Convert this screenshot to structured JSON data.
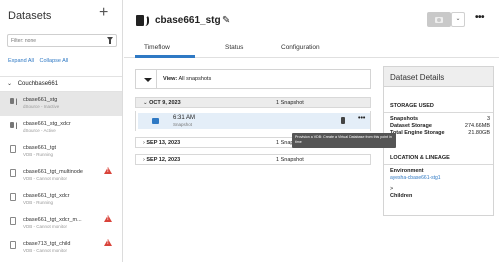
{
  "sidebar": {
    "title": "Datasets",
    "add_glyph": "+",
    "filter_placeholder": "Filter: none",
    "expand_all": "Expand All",
    "collapse_all": "Collapse All",
    "group": "Couchbase661",
    "items": [
      {
        "name": "cbase661_stg",
        "status": "dSource - Inactive",
        "type": "source",
        "selected": true,
        "warning": false
      },
      {
        "name": "cbase661_stg_xdcr",
        "status": "dSource - Active",
        "type": "source",
        "selected": false,
        "warning": false
      },
      {
        "name": "cbase661_tgt",
        "status": "VDB - Running",
        "type": "vdb",
        "selected": false,
        "warning": false
      },
      {
        "name": "cbase661_tgt_multinode",
        "status": "VDB - Cannot monitor",
        "type": "vdb",
        "selected": false,
        "warning": true
      },
      {
        "name": "cbase661_tgt_xdcr",
        "status": "VDB - Running",
        "type": "vdb",
        "selected": false,
        "warning": false
      },
      {
        "name": "cbase661_tgt_xdcr_m...",
        "status": "VDB - Cannot monitor",
        "type": "vdb",
        "selected": false,
        "warning": true
      },
      {
        "name": "cbase713_tgt_child",
        "status": "VDB - Cannot monitor",
        "type": "vdb",
        "selected": false,
        "warning": true
      }
    ]
  },
  "header": {
    "title": "cbase661_stg",
    "dropdown_glyph": "⌄",
    "more_glyph": "•••",
    "tabs": [
      "Timeflow",
      "Status",
      "Configuration"
    ],
    "active_tab": "Timeflow"
  },
  "timeflow": {
    "view_label": "View:",
    "view_value": "All snapshots",
    "dates": [
      {
        "date": "OCT 9, 2023",
        "count": "1 Snapshot",
        "expanded": true,
        "chevron": "⌄"
      },
      {
        "date": "SEP 13, 2023",
        "count": "1 Snapshot",
        "expanded": false,
        "chevron": "›"
      },
      {
        "date": "SEP 12, 2023",
        "count": "1 Snapshot",
        "expanded": false,
        "chevron": "›"
      }
    ],
    "snapshot": {
      "time": "6:31 AM",
      "label": "Snapshot",
      "more": "•••"
    },
    "tooltip": "Provision a VDB: Create a Virtual Database from this point in time"
  },
  "details": {
    "title": "Dataset Details",
    "storage_heading": "STORAGE USED",
    "storage_rows": [
      {
        "label": "Snapshots",
        "value": "3"
      },
      {
        "label": "Dataset Storage",
        "value": "274.66MB"
      },
      {
        "label": "Total Engine Storage",
        "value": "21.80GB"
      }
    ],
    "lineage_heading": "LOCATION & LINEAGE",
    "environment_label": "Environment",
    "environment_value": "ayesha-cbase661-stg1",
    "children_chevron": ">",
    "children_label": "Children"
  },
  "colors": {
    "accent": "#2f79c4",
    "warning": "#d9433a",
    "selected_bg": "#e6e6e6",
    "tooltip_bg": "#555555"
  }
}
